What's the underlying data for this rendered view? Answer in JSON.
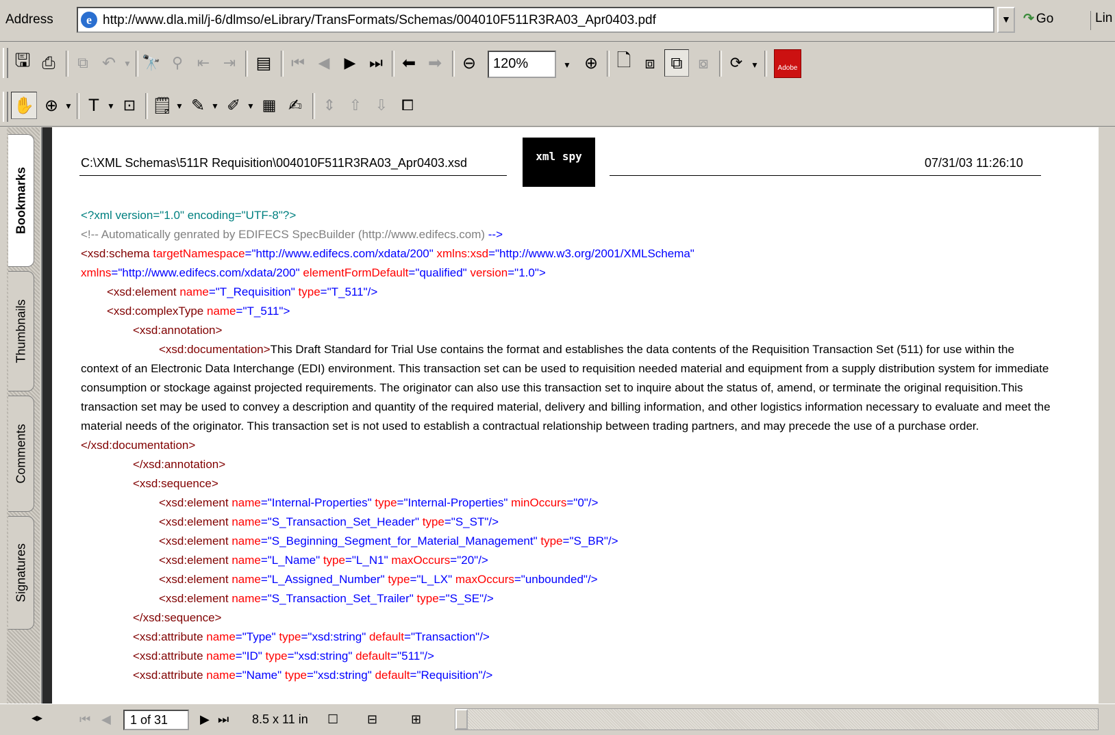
{
  "address_bar": {
    "label": "Address",
    "url": "http://www.dla.mil/j-6/dlmso/eLibrary/TransFormats/Schemas/004010F511R3RA03_Apr0403.pdf",
    "go_label": "Go",
    "links_label": "Lin"
  },
  "toolbar": {
    "zoom_value": "120%",
    "adobe_label": "Adobe"
  },
  "side_tabs": [
    "Bookmarks",
    "Thumbnails",
    "Comments",
    "Signatures"
  ],
  "document": {
    "file_path": "C:\\XML Schemas\\511R Requisition\\004010F511R3RA03_Apr0403.xsd",
    "logo_text": "xml spy",
    "timestamp": "07/31/03 11:26:10",
    "lines": {
      "l1": "<?xml version=\"1.0\" encoding=\"UTF-8\"?>",
      "l2a": "<!-- Automatically genrated by EDIFECS SpecBuilder (http://www.edifecs.com)",
      "l2b": " -->",
      "l3_tag": "<xsd:schema",
      "l3_a1": " targetNamespace",
      "l3_v1": "=\"http://www.edifecs.com/xdata/200\"",
      "l3_a2": " xmlns:xsd",
      "l3_v2": "=\"http://www.w3.org/2001/XMLSchema\"",
      "l4_a1": "xmlns",
      "l4_v1": "=\"http://www.edifecs.com/xdata/200\"",
      "l4_a2": " elementFormDefault",
      "l4_v2": "=\"qualified\"",
      "l4_a3": " version",
      "l4_v3": "=\"1.0\">",
      "l5_tag": "<xsd:element",
      "l5_a1": " name",
      "l5_v1": "=\"T_Requisition\"",
      "l5_a2": " type",
      "l5_v2": "=\"T_511\"/>",
      "l6_tag": "<xsd:complexType",
      "l6_a1": " name",
      "l6_v1": "=\"T_511\">",
      "l7": "<xsd:annotation>",
      "l8_tag": "<xsd:documentation>",
      "l8_text": "This Draft Standard for Trial Use contains the format and establishes the data contents of the Requisition Transaction Set (511) for use within the context of an Electronic Data Interchange (EDI) environment. This transaction set can be used to requisition needed material and equipment from a supply distribution system for immediate consumption or stockage against projected requirements. The originator can also use this transaction set to inquire about the status of, amend, or terminate the original requisition.This transaction set may be used to convey a description and quantity of the required material, delivery and billing information, and other logistics information necessary to evaluate and meet the material needs of the originator. This transaction set is not used to establish a contractual relationship between trading partners, and may precede the use of a purchase order.",
      "l9": "</xsd:documentation>",
      "l10": "</xsd:annotation>",
      "l11": "<xsd:sequence>",
      "el1_v1": "=\"Internal-Properties\"",
      "el1_v2": "=\"Internal-Properties\"",
      "el1_a3": " minOccurs",
      "el1_v3": "=\"0\"/>",
      "el2_v1": "=\"S_Transaction_Set_Header\"",
      "el2_v2": "=\"S_ST\"/>",
      "el3_v1": "=\"S_Beginning_Segment_for_Material_Management\"",
      "el3_v2": "=\"S_BR\"/>",
      "el4_v1": "=\"L_Name\"",
      "el4_v2": "=\"L_N1\"",
      "el4_a3": " maxOccurs",
      "el4_v3": "=\"20\"/>",
      "el5_v1": "=\"L_Assigned_Number\"",
      "el5_v2": "=\"L_LX\"",
      "el5_a3": " maxOccurs",
      "el5_v3": "=\"unbounded\"/>",
      "el6_v1": "=\"S_Transaction_Set_Trailer\"",
      "el6_v2": "=\"S_SE\"/>",
      "l12": "</xsd:sequence>",
      "attr_tag": "<xsd:attribute",
      "at1_v1": "=\"Type\"",
      "at1_v2": "=\"xsd:string\"",
      "at1_a3": " default",
      "at1_v3": "=\"Transaction\"/>",
      "at2_v1": "=\"ID\"",
      "at2_v2": "=\"xsd:string\"",
      "at2_a3": " default",
      "at2_v3": "=\"511\"/>",
      "at3_v1": "=\"Name\"",
      "at3_v2": "=\"xsd:string\"",
      "at3_a3": " default",
      "at3_v3": "=\"Requisition\"/>",
      "el_tag": "<xsd:element",
      "name_attr": " name",
      "type_attr": " type"
    }
  },
  "status_bar": {
    "page_info": "1 of 31",
    "page_size": "8.5 x 11 in"
  }
}
